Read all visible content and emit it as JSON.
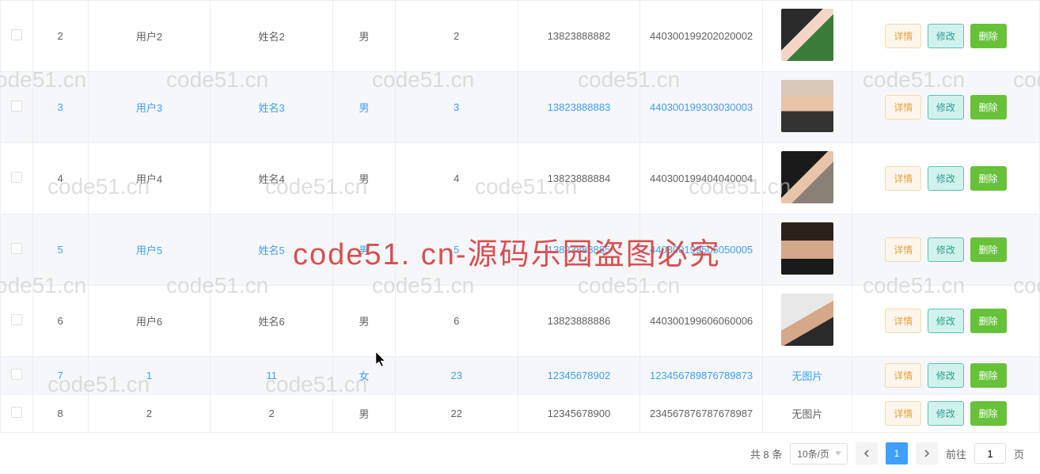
{
  "rows": [
    {
      "id": "2",
      "user": "用户2",
      "name": "姓名2",
      "gender": "男",
      "num": "2",
      "phone": "13823888882",
      "idcard": "440300199202020002",
      "avatar": "av1",
      "noimg": false,
      "hover": false,
      "short": false
    },
    {
      "id": "3",
      "user": "用户3",
      "name": "姓名3",
      "gender": "男",
      "num": "3",
      "phone": "13823888883",
      "idcard": "440300199303030003",
      "avatar": "av2",
      "noimg": false,
      "hover": true,
      "short": false
    },
    {
      "id": "4",
      "user": "用户4",
      "name": "姓名4",
      "gender": "男",
      "num": "4",
      "phone": "13823888884",
      "idcard": "440300199404040004",
      "avatar": "av3",
      "noimg": false,
      "hover": false,
      "short": false
    },
    {
      "id": "5",
      "user": "用户5",
      "name": "姓名5",
      "gender": "男",
      "num": "5",
      "phone": "13823888885",
      "idcard": "440300199505050005",
      "avatar": "av4",
      "noimg": false,
      "hover": true,
      "short": false
    },
    {
      "id": "6",
      "user": "用户6",
      "name": "姓名6",
      "gender": "男",
      "num": "6",
      "phone": "13823888886",
      "idcard": "440300199606060006",
      "avatar": "av5",
      "noimg": false,
      "hover": false,
      "short": false
    },
    {
      "id": "7",
      "user": "1",
      "name": "11",
      "gender": "女",
      "num": "23",
      "phone": "12345678902",
      "idcard": "123456789876789873",
      "avatar": "",
      "noimg": true,
      "hover": true,
      "short": true
    },
    {
      "id": "8",
      "user": "2",
      "name": "2",
      "gender": "男",
      "num": "22",
      "phone": "12345678900",
      "idcard": "234567876787678987",
      "avatar": "",
      "noimg": true,
      "hover": false,
      "short": true
    }
  ],
  "actions": {
    "detail": "详情",
    "edit": "修改",
    "delete": "删除"
  },
  "noimg_label": "无图片",
  "pagination": {
    "total_label": "共 8 条",
    "pagesize": "10条/页",
    "current": "1",
    "goto_prefix": "前往",
    "goto_value": "1",
    "goto_suffix": "页"
  },
  "watermarks": [
    "code51.cn",
    "code51.cn",
    "code51.cn",
    "code51.cn",
    "code51.cn",
    "code51.cn",
    "code51.cn",
    "code51.cn",
    "code51.cn",
    "code51.cn",
    "code51.cn",
    "code51.cn",
    "code51.cn",
    "code51.cn",
    "code51.cn",
    "code51.cn",
    "code51.cn",
    "code51.cn"
  ],
  "center_text": "code51. cn-源码乐园盗图必究"
}
